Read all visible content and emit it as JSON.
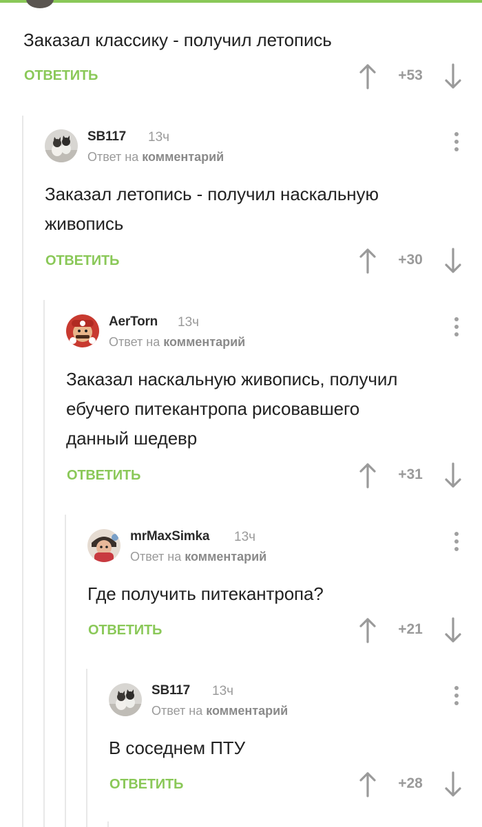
{
  "colors": {
    "accent": "#8ac858",
    "text": "#222222",
    "muted": "#9a9a9a",
    "thread_line": "#e8e8e8"
  },
  "root_comment": {
    "text": "Заказал классику - получил летопись",
    "reply_label": "ОТВЕТИТЬ",
    "score": "+53"
  },
  "comments": [
    {
      "author": "SB117",
      "time": "13ч",
      "reply_to_prefix": "Ответ на",
      "reply_to_link": "комментарий",
      "text_lines": [
        "Заказал летопись - получил наскальную",
        "живопись"
      ],
      "reply_label": "ОТВЕТИТЬ",
      "score": "+30",
      "avatar": "cat-avatar"
    },
    {
      "author": "AerTorn",
      "time": "13ч",
      "reply_to_prefix": "Ответ на",
      "reply_to_link": "комментарий",
      "text_lines": [
        "Заказал наскальную живопись, получил",
        "ебучего питекантропа рисовавшего",
        "данный шедевр"
      ],
      "reply_label": "ОТВЕТИТЬ",
      "score": "+31",
      "avatar": "mario-avatar"
    },
    {
      "author": "mrMaxSimka",
      "time": "13ч",
      "reply_to_prefix": "Ответ на",
      "reply_to_link": "комментарий",
      "text_lines": [
        "Где получить питекантропа?"
      ],
      "reply_label": "ОТВЕТИТЬ",
      "score": "+21",
      "avatar": "person-avatar"
    },
    {
      "author": "SB117",
      "time": "13ч",
      "reply_to_prefix": "Ответ на",
      "reply_to_link": "комментарий",
      "text_lines": [
        "В соседнем ПТУ"
      ],
      "reply_label": "ОТВЕТИТЬ",
      "score": "+28",
      "avatar": "cat-avatar"
    }
  ]
}
